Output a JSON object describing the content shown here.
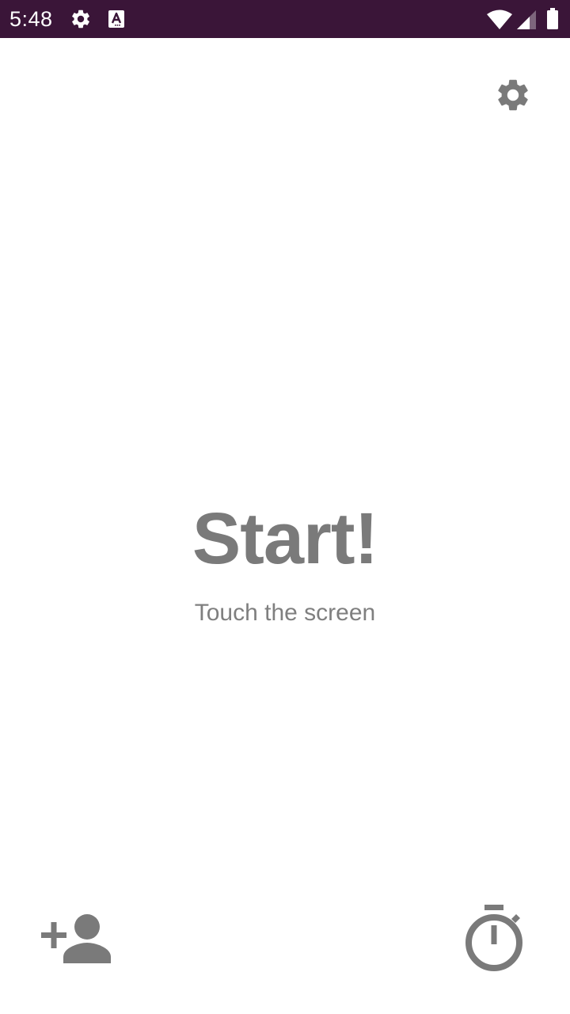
{
  "status_bar": {
    "time": "5:48",
    "background_color": "#3a1538",
    "left_icons": [
      "gear-icon",
      "accessibility-a-icon"
    ],
    "right_icons": [
      "wifi-icon",
      "cellular-signal-icon",
      "battery-icon"
    ]
  },
  "main": {
    "title": "Start!",
    "subtitle": "Touch the screen",
    "text_color": "#7a7a7a"
  },
  "toolbar": {
    "settings_icon": "gear-icon",
    "add_player_icon": "person-add-icon",
    "timer_icon": "stopwatch-icon"
  }
}
